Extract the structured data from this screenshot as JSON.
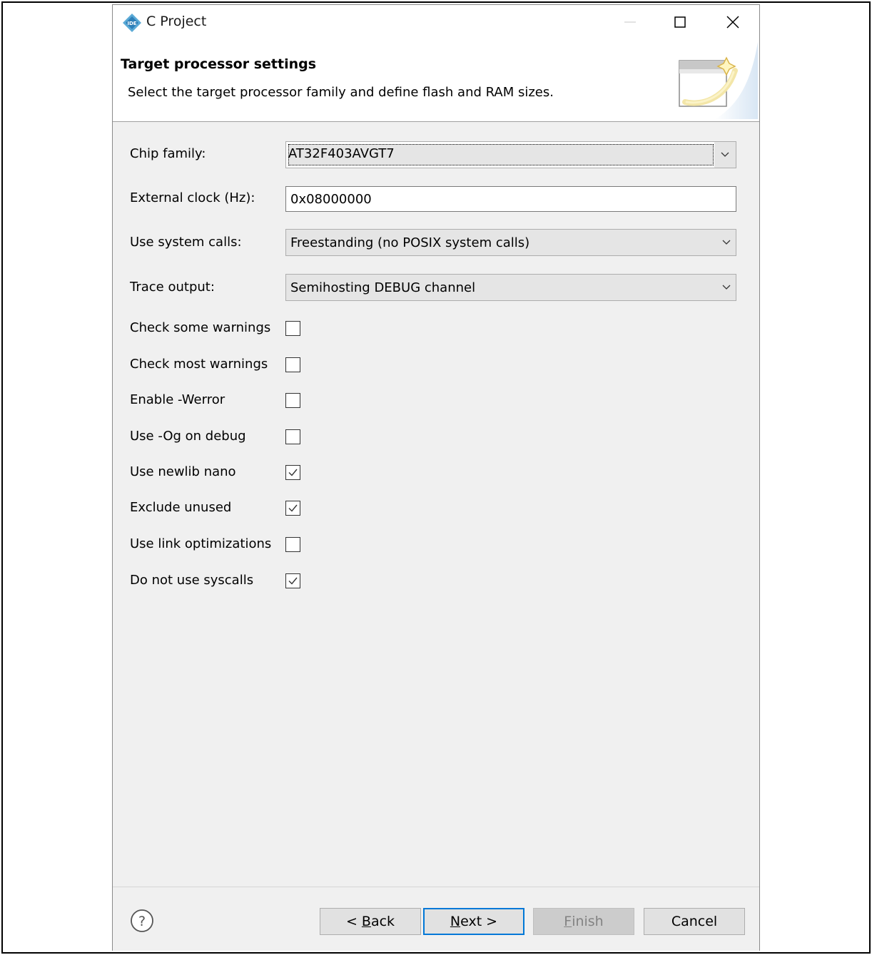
{
  "window": {
    "title": "C Project",
    "app_icon": "ide-icon",
    "app_icon_text": "IDE"
  },
  "header": {
    "title": "Target processor settings",
    "description": "Select the target processor family and define flash and RAM sizes."
  },
  "form": {
    "chip_family": {
      "label": "Chip family:",
      "value": "AT32F403AVGT7"
    },
    "external_clock": {
      "label": "External clock (Hz):",
      "value": "0x08000000"
    },
    "system_calls": {
      "label": "Use system calls:",
      "value": "Freestanding (no POSIX system calls)"
    },
    "trace_output": {
      "label": "Trace output:",
      "value": "Semihosting DEBUG channel"
    },
    "checkboxes": [
      {
        "label": "Check some warnings",
        "checked": false
      },
      {
        "label": "Check most warnings",
        "checked": false
      },
      {
        "label": "Enable -Werror",
        "checked": false
      },
      {
        "label": "Use -Og on debug",
        "checked": false
      },
      {
        "label": "Use newlib nano",
        "checked": true
      },
      {
        "label": "Exclude unused",
        "checked": true
      },
      {
        "label": "Use link optimizations",
        "checked": false
      },
      {
        "label": "Do not use syscalls",
        "checked": true
      }
    ]
  },
  "footer": {
    "back": {
      "prefix": "< ",
      "mnemonic": "B",
      "rest": "ack"
    },
    "next": {
      "mnemonic": "N",
      "rest": "ext >"
    },
    "finish": {
      "mnemonic": "F",
      "rest": "inish"
    },
    "cancel": {
      "label": "Cancel"
    }
  },
  "colors": {
    "default_button_border": "#0078d7",
    "body_background": "#f0f0f0",
    "disabled_text": "#838383"
  }
}
